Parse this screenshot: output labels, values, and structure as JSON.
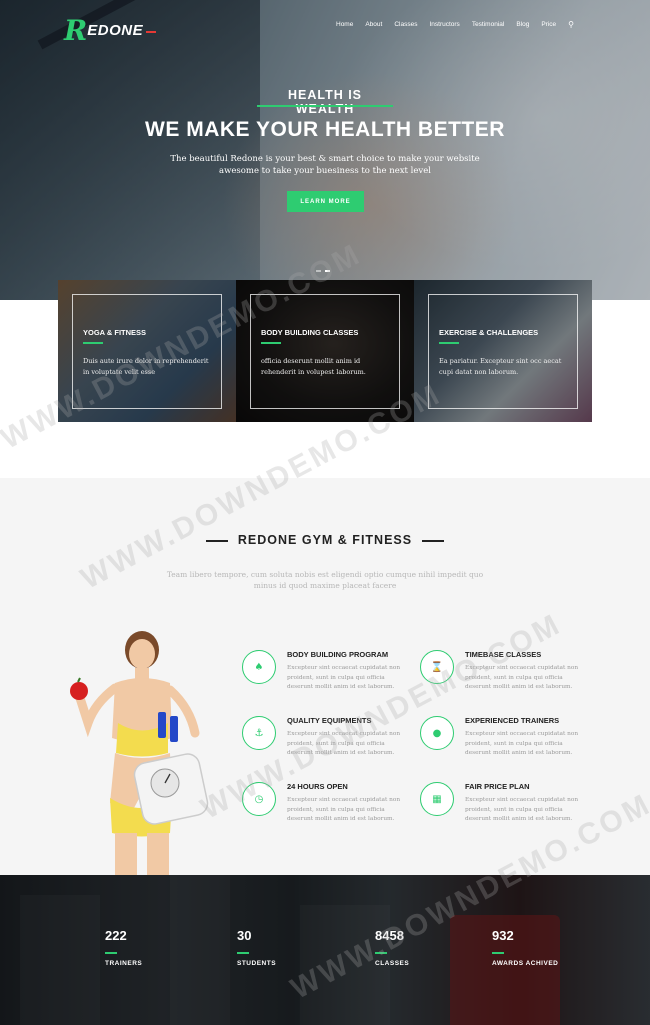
{
  "brand": {
    "logo_letter": "R",
    "logo_text": "EDONE",
    "accent": "#2ecc71",
    "logo_dash_color": "#e53935"
  },
  "nav": {
    "items": [
      "Home",
      "About",
      "Classes",
      "Instructors",
      "Testimonial",
      "Blog",
      "Price"
    ],
    "search_icon": "search-icon"
  },
  "hero": {
    "tagline": "HEALTH IS WEALTH",
    "headline": "WE MAKE YOUR HEALTH BETTER",
    "subtext": "The beautiful Redone is your best & smart choice to make your website awesome to take your buesiness to the next level",
    "button": "LEARN MORE"
  },
  "classes": [
    {
      "title": "YOGA & FITNESS",
      "text": "Duis aute irure dolor in reprehenderit in voluptate velit esse"
    },
    {
      "title": "BODY BUILDING CLASSES",
      "text": "officia deserunt mollit anim id rehenderit in volupest laborum."
    },
    {
      "title": "EXERCISE & CHALLENGES",
      "text": "Ea pariatur. Excepteur sint occ aecat cupi datat non laborum."
    }
  ],
  "about": {
    "title": "REDONE GYM & FITNESS",
    "subtitle": "Team libero tempore, cum soluta nobis est eligendi optio cumque nihil impedit quo minus id quod maxime placeat facere",
    "features": [
      {
        "title": "BODY BUILDING PROGRAM",
        "icon": "leaf-icon",
        "glyph": "♠",
        "text": "Excepteur sint occaecat cupidatat non proident, sunt in culpa qui officia deserunt mollit anim id est laborum."
      },
      {
        "title": "TIMEBASE CLASSES",
        "icon": "hourglass-icon",
        "glyph": "⌛",
        "text": "Excepteur sint occaecat cupidatat non proident, sunt in culpa qui officia deserunt mollit anim id est laborum."
      },
      {
        "title": "QUALITY EQUIPMENTS",
        "icon": "anchor-icon",
        "glyph": "⚓",
        "text": "Excepteur sint occaecat cupidatat non proident, sunt in culpa qui officia deserunt mollit anim id est laborum."
      },
      {
        "title": "EXPERIENCED TRAINERS",
        "icon": "user-icon",
        "glyph": "●",
        "text": "Excepteur sint occaecat cupidatat non proident, sunt in culpa qui officia deserunt mollit anim id est laborum."
      },
      {
        "title": "24 HOURS OPEN",
        "icon": "clock-icon",
        "glyph": "◷",
        "text": "Excepteur sint occaecat cupidatat non proident, sunt in culpa qui officia deserunt mollit anim id est laborum."
      },
      {
        "title": "FAIR PRICE PLAN",
        "icon": "calculator-icon",
        "glyph": "▦",
        "text": "Excepteur sint occaecat cupidatat non proident, sunt in culpa qui officia deserunt mollit anim id est laborum."
      }
    ]
  },
  "stats": [
    {
      "number": "222",
      "label": "TRAINERS"
    },
    {
      "number": "30",
      "label": "STUDENTS"
    },
    {
      "number": "8458",
      "label": "CLASSES"
    },
    {
      "number": "932",
      "label": "AWARDS ACHIVED"
    }
  ],
  "watermark": "WWW.DOWNDEMO.COM"
}
